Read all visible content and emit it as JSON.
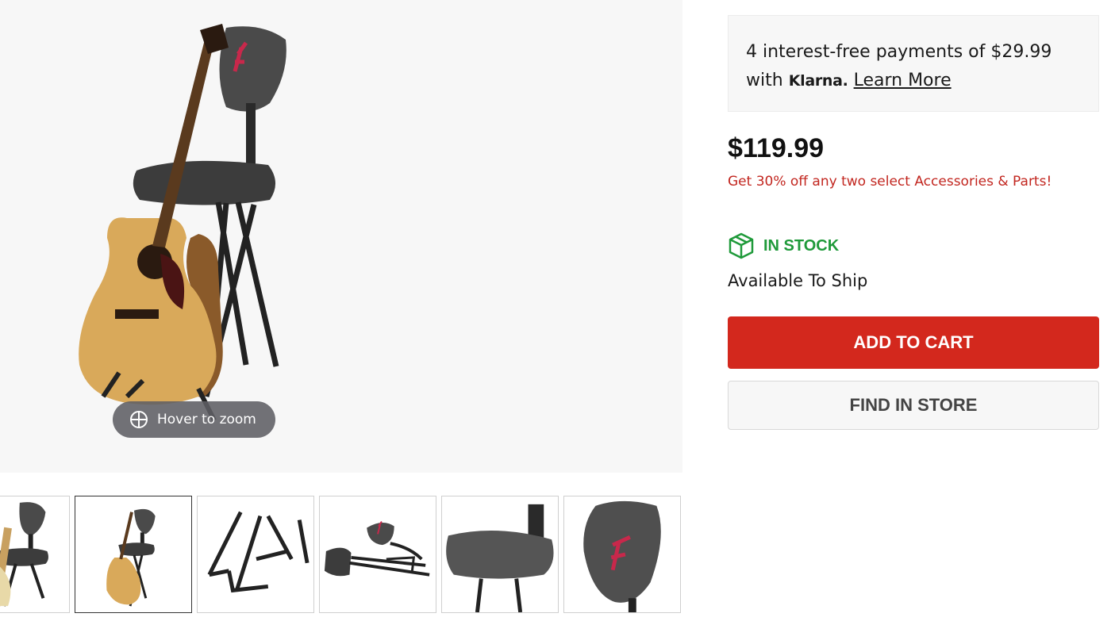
{
  "gallery": {
    "zoom_hint": "Hover to zoom",
    "zoom_icon": "zoom-crosshair-icon",
    "thumbnails": [
      {
        "name": "thumb-electric-guitar-on-seat"
      },
      {
        "name": "thumb-acoustic-guitar-on-seat"
      },
      {
        "name": "thumb-guitar-stand-legs"
      },
      {
        "name": "thumb-folded-seat"
      },
      {
        "name": "thumb-seat-cushion"
      },
      {
        "name": "thumb-backrest"
      }
    ],
    "active_thumbnail_index": 1
  },
  "klarna": {
    "line1": "4 interest-free payments of $29.99",
    "with": "with",
    "brand": "Klarna.",
    "learn_more": "Learn More"
  },
  "price": {
    "amount": "$119.99",
    "promo": "Get 30% off any two select Accessories & Parts!"
  },
  "stock": {
    "icon": "package-box-icon",
    "status": "IN STOCK",
    "availability": "Available To Ship"
  },
  "actions": {
    "add_to_cart": "ADD TO CART",
    "find_in_store": "FIND IN STORE"
  },
  "colors": {
    "accent_red": "#d3281d",
    "promo_red": "#c2261f",
    "stock_green": "#1f9a3a"
  }
}
